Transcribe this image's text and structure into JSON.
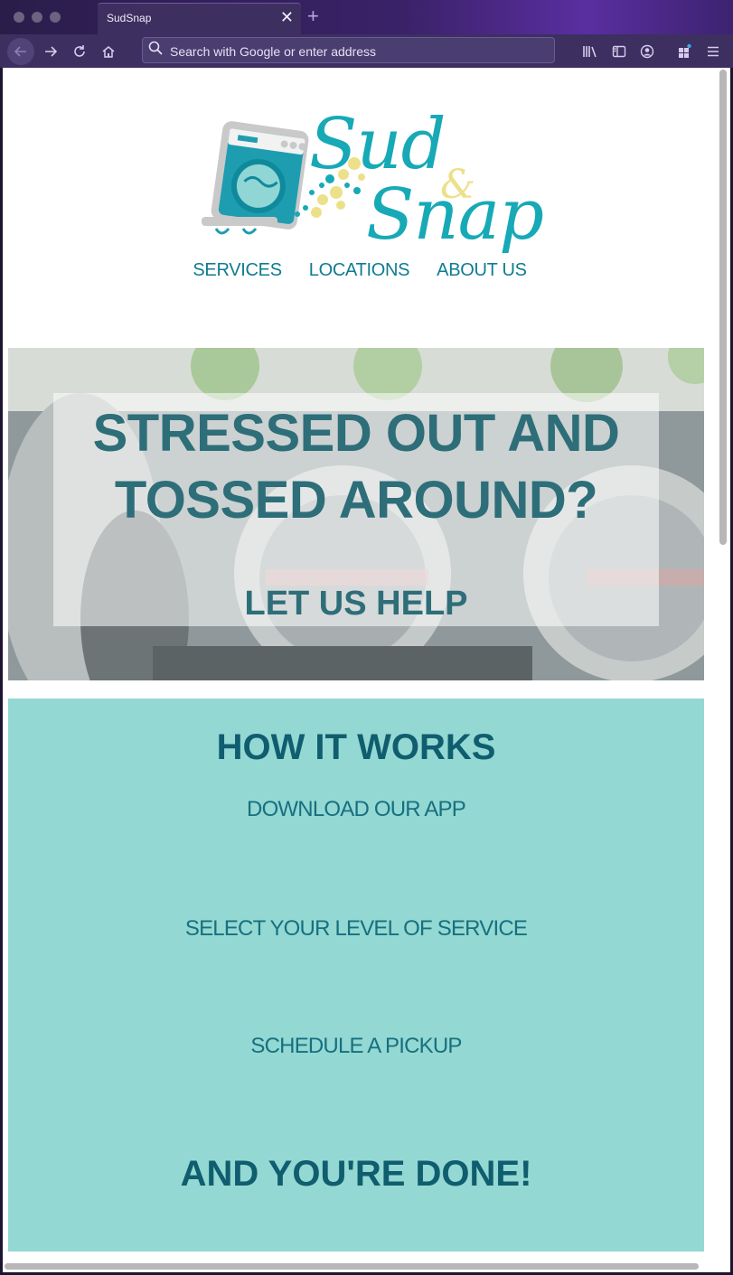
{
  "browser": {
    "tab_title": "SudSnap",
    "tab_close": "✕",
    "new_tab": "+",
    "url_placeholder": "Search with Google or enter address",
    "icons": [
      "back-icon",
      "forward-icon",
      "reload-icon",
      "home-icon",
      "search-icon",
      "library-icon",
      "sidebar-icon",
      "account-icon",
      "extensions-icon",
      "menu-icon"
    ]
  },
  "logo": {
    "sud": "Sud",
    "amp": "&",
    "snap": "Snap",
    "colors": {
      "teal": "#17a9b6",
      "yellow": "#ede08a",
      "gray": "#c9c9c9"
    }
  },
  "nav": {
    "items": [
      "SERVICES",
      "LOCATIONS",
      "ABOUT US"
    ]
  },
  "hero": {
    "title": "STRESSED OUT AND TOSSED AROUND?",
    "subtitle": "LET US HELP"
  },
  "how_it_works": {
    "title": "HOW IT WORKS",
    "steps": [
      "DOWNLOAD OUR APP",
      "SELECT YOUR LEVEL OF SERVICE",
      "SCHEDULE A PICKUP"
    ],
    "closing": "AND YOU'RE DONE!",
    "background": "#94d8d3"
  }
}
